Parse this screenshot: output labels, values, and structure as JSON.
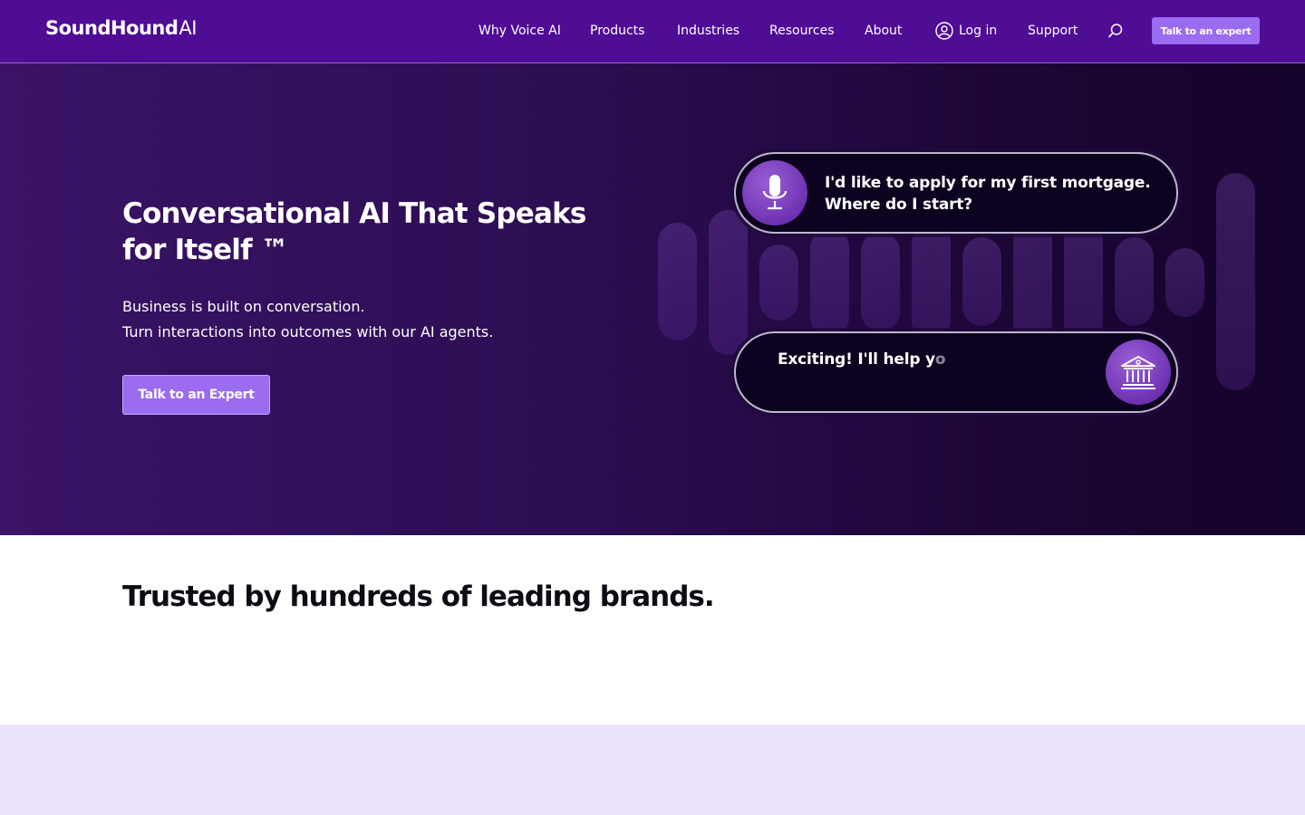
{
  "nav": {
    "logo_main": "SoundHound",
    "logo_ai": "AI",
    "items": [
      {
        "label": "Why Voice AI"
      },
      {
        "label": "Products"
      },
      {
        "label": "Industries"
      },
      {
        "label": "Resources"
      },
      {
        "label": "About"
      }
    ],
    "login_label": "Log in",
    "support_label": "Support",
    "search_icon": "search-icon",
    "cta_label": "Talk to an expert"
  },
  "hero": {
    "title": "Conversational AI That Speaks for Itself ™",
    "subtitle_line1": "Business is built on conversation.",
    "subtitle_line2": "Turn interactions into outcomes with our AI agents.",
    "cta_label": "Talk to an Expert",
    "question_line1": "I'd like to apply for my first mortgage.",
    "question_line2": "Where do I start?",
    "answer_visible": "Exciting! I'll help y",
    "answer_fading": "o",
    "mic_icon": "microphone-icon",
    "bank_icon": "bank-icon"
  },
  "brands": {
    "title": "Trusted by hundreds of leading brands."
  },
  "colors": {
    "nav_bg": "#4f0c95",
    "accent": "#9b6bf0",
    "hero_bg": "#2c0d52",
    "lavender": "#ede3ff"
  }
}
